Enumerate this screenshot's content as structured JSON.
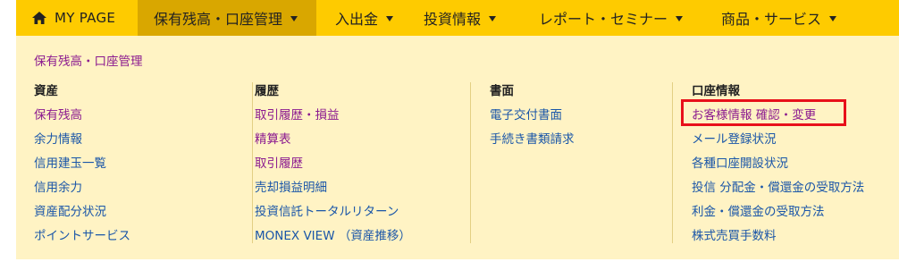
{
  "topnav": {
    "items": [
      {
        "label": "MY PAGE",
        "icon": "home-icon"
      },
      {
        "label": "保有残高・口座管理",
        "active": true
      },
      {
        "label": "入出金"
      },
      {
        "label": "投資情報"
      },
      {
        "label": "レポート・セミナー"
      },
      {
        "label": "商品・サービス"
      }
    ]
  },
  "dropdown": {
    "title": "保有残高・口座管理",
    "columns": [
      {
        "heading": "資産",
        "links": [
          "保有残高",
          "余力情報",
          "信用建玉一覧",
          "信用余力",
          "資産配分状況",
          "ポイントサービス"
        ]
      },
      {
        "heading": "履歴",
        "links": [
          "取引履歴・損益",
          "精算表",
          "取引履歴",
          "売却損益明細",
          "投資信託トータルリターン",
          "MONEX VIEW （資産推移）"
        ]
      },
      {
        "heading": "書面",
        "links": [
          "電子交付書面",
          "手続き書類請求"
        ]
      },
      {
        "heading": "口座情報",
        "links": [
          "お客様情報 確認・変更",
          "メール登録状況",
          "各種口座開設状況",
          "投信 分配金・償還金の受取方法",
          "利金・償還金の受取方法",
          "株式売買手数料"
        ]
      }
    ]
  },
  "colors": {
    "nav_bg": "#fecb00",
    "nav_active_bg": "#d9a700",
    "panel_bg": "#fff3c4",
    "link_visited": "#8b1a8f",
    "link_normal": "#1a56a8",
    "highlight": "#e8101a"
  }
}
